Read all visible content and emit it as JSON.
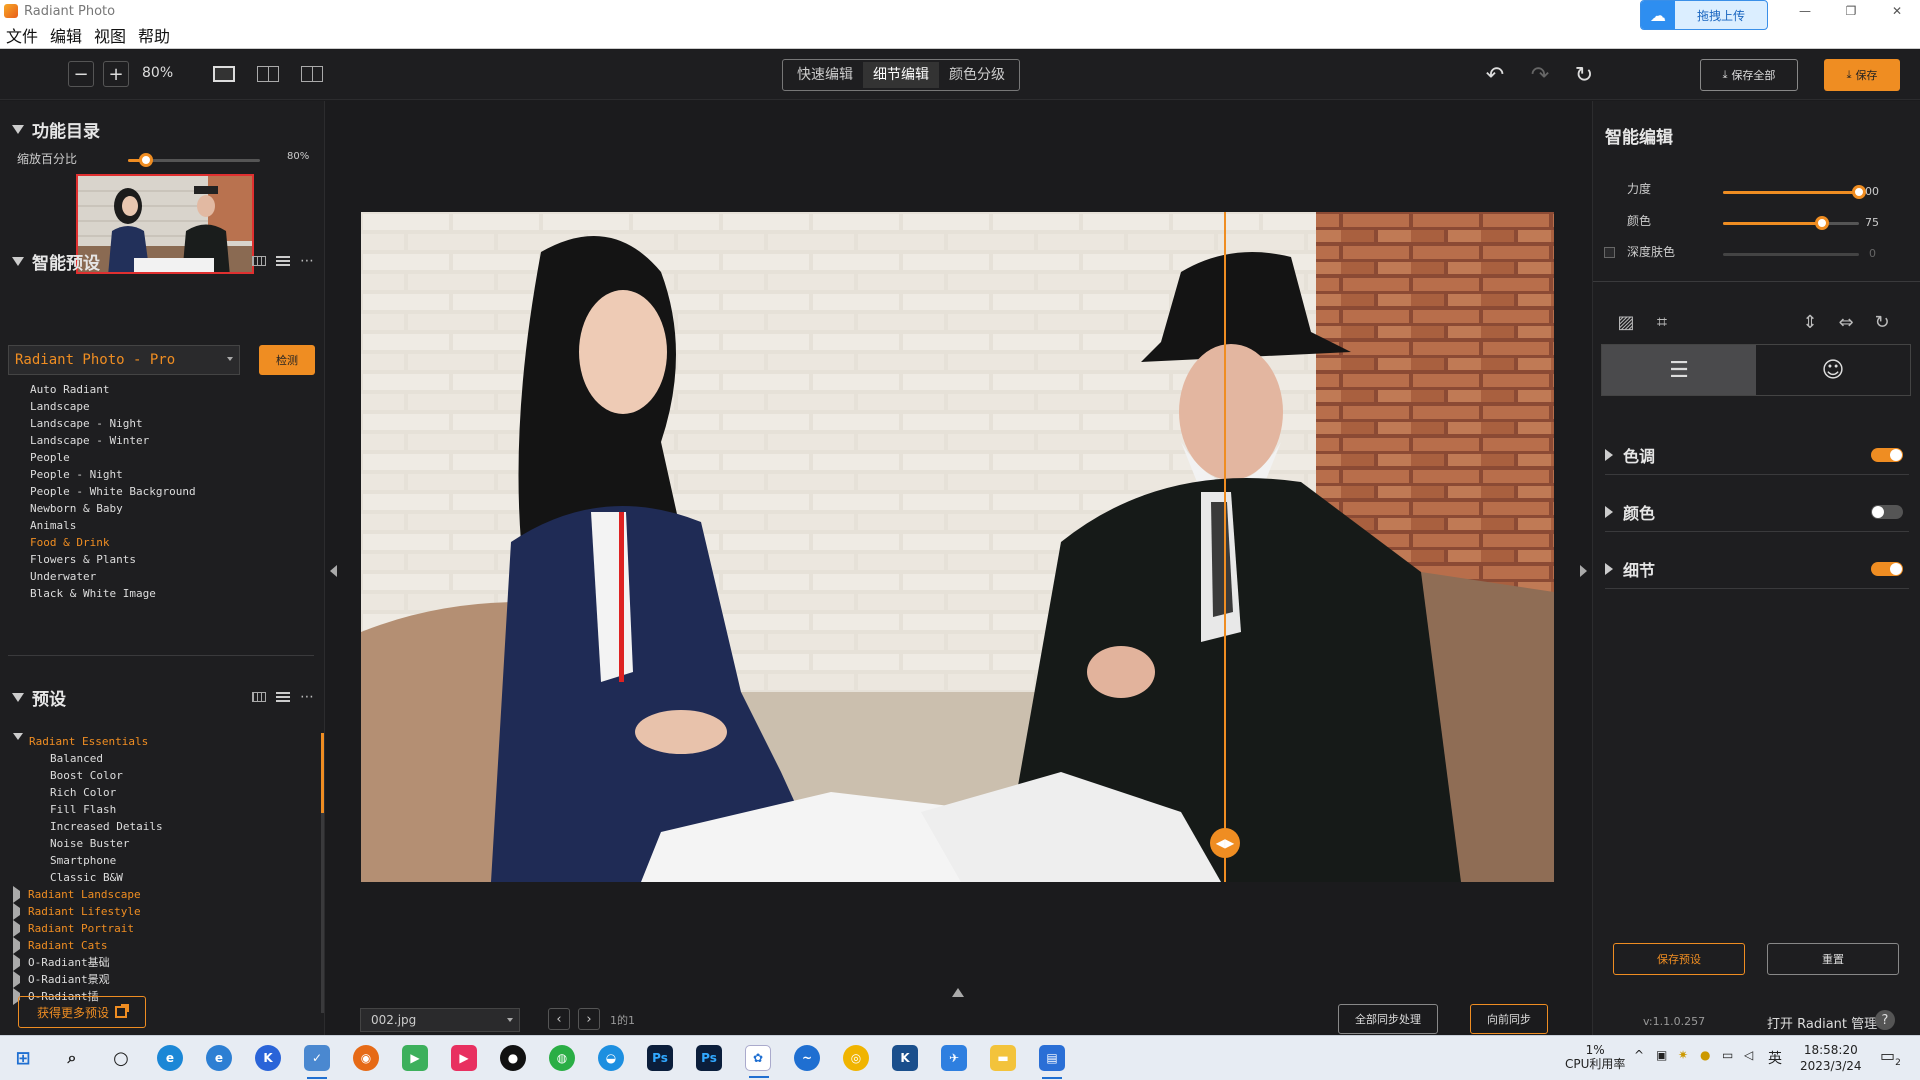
{
  "window": {
    "title": "Radiant Photo"
  },
  "upload_button": {
    "label": "拖拽上传"
  },
  "menu": [
    "文件",
    "编辑",
    "视图",
    "帮助"
  ],
  "toolbar": {
    "zoom": "80%",
    "modes": [
      "快速编辑",
      "细节编辑",
      "颜色分级"
    ],
    "active_mode": "细节编辑",
    "save_all": "保存全部",
    "save": "保存"
  },
  "left": {
    "catalog": {
      "title": "功能目录",
      "zoom_label": "缩放百分比",
      "zoom_value": "80%",
      "zoom_fraction": 0.14
    },
    "smart_presets": {
      "title": "智能预设",
      "selected": "Radiant Photo - Pro",
      "detect": "检测",
      "items": [
        "Auto Radiant",
        "Landscape",
        "Landscape - Night",
        "Landscape - Winter",
        "People",
        "People - Night",
        "People - White Background",
        "Newborn & Baby",
        "Animals",
        "Food & Drink",
        "Flowers & Plants",
        "Underwater",
        "Black & White Image"
      ],
      "highlighted": "Food & Drink"
    },
    "presets": {
      "title": "预设",
      "essentials": {
        "name": "Radiant Essentials",
        "children": [
          "Balanced",
          "Boost Color",
          "Rich Color",
          "Fill Flash",
          "Increased Details",
          "Noise Buster",
          "Smartphone",
          "Classic B&W"
        ]
      },
      "orange_groups": [
        "Radiant Landscape",
        "Radiant Lifestyle",
        "Radiant Portrait",
        "Radiant Cats"
      ],
      "other_groups": [
        "O-Radiant基础",
        "O-Radiant景观",
        "O-Radiant插"
      ]
    },
    "more_presets": "获得更多预设"
  },
  "center": {
    "file_name": "002.jpg",
    "page_count": "1的1",
    "sync_all": "全部同步处理",
    "sync_forward": "向前同步"
  },
  "right": {
    "title": "智能编辑",
    "sliders": [
      {
        "label": "力度",
        "value": "00",
        "fraction": 1.0
      },
      {
        "label": "颜色",
        "value": "75",
        "fraction": 0.73
      },
      {
        "label": "深度肤色",
        "value": "0",
        "fraction": 0.0,
        "checkbox": true
      }
    ],
    "sections": [
      {
        "name": "色调",
        "enabled": true
      },
      {
        "name": "颜色",
        "enabled": false
      },
      {
        "name": "细节",
        "enabled": true
      }
    ],
    "save_preset": "保存预设",
    "reset": "重置",
    "version": "v:1.1.0.257",
    "manage": "打开 Radiant 管理",
    "help": "?"
  },
  "taskbar": {
    "cpu_percent": "1%",
    "cpu_label": "CPU利用率",
    "ime": "英",
    "time": "18:58:20",
    "date": "2023/3/24",
    "notifications": "2"
  },
  "colors": {
    "accent": "#ef8d22",
    "panel": "#1e1e20",
    "canvas": "#1b1b1d"
  }
}
